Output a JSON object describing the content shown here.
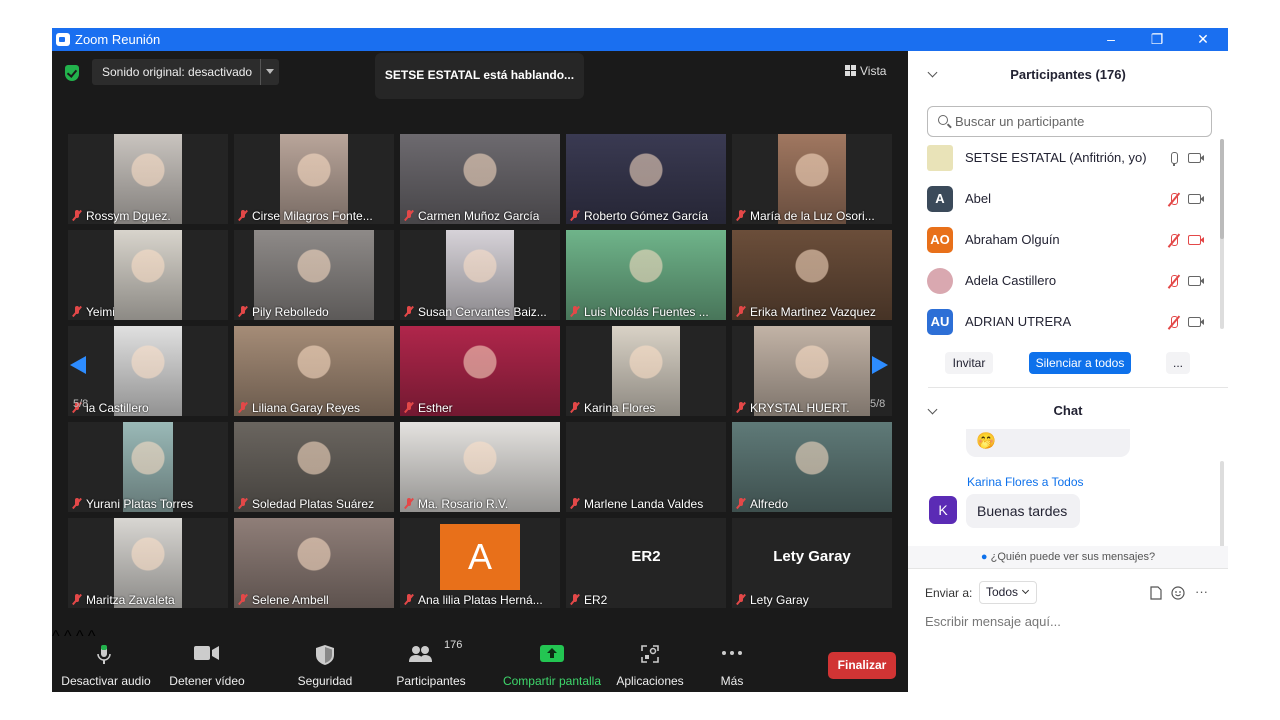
{
  "window": {
    "title": "Zoom Reunión",
    "minimize": "–",
    "restore": "❐",
    "close": "✕"
  },
  "topbar": {
    "audio_label": "Sonido original: desactivado",
    "speaking": "SETSE ESTATAL está hablando...",
    "view_label": "Vista"
  },
  "grid": {
    "page_left": "5/8",
    "page_right": "5/8",
    "tiles": [
      {
        "name": "Rossym Dguez.",
        "bg": "#c9c4bf",
        "kind": "video"
      },
      {
        "name": "Cirse Milagros Fonte...",
        "bg": "#b9a59a",
        "kind": "video"
      },
      {
        "name": "Carmen Muñoz García",
        "bg": "#6d6a6f",
        "kind": "video"
      },
      {
        "name": "Roberto Gómez García",
        "bg": "#3a3a52",
        "kind": "video"
      },
      {
        "name": "María de la Luz Osori...",
        "bg": "#a07760",
        "kind": "video"
      },
      {
        "name": "Yeimi",
        "bg": "#d8d4cc",
        "kind": "video"
      },
      {
        "name": "Pily Rebolledo",
        "bg": "#8e8a88",
        "kind": "video"
      },
      {
        "name": "Susan Cervantes Baiz...",
        "bg": "#d6d2d8",
        "kind": "video"
      },
      {
        "name": "Luis Nicolás Fuentes ...",
        "bg": "#6fb48a",
        "kind": "video"
      },
      {
        "name": "Erika Martinez Vazquez",
        "bg": "#6b4e3a",
        "kind": "video"
      },
      {
        "name": "la Castillero",
        "bg": "#e0e0e0",
        "kind": "video"
      },
      {
        "name": "Liliana Garay Reyes",
        "bg": "#a58c77",
        "kind": "video"
      },
      {
        "name": "Esther",
        "bg": "#b0264b",
        "kind": "video"
      },
      {
        "name": "Karina Flores",
        "bg": "#d9d2c6",
        "kind": "video"
      },
      {
        "name": "KRYSTAL HUERT.",
        "bg": "#c2b3a6",
        "kind": "video"
      },
      {
        "name": "Yurani Platas Torres",
        "bg": "#9ab9b7",
        "kind": "video"
      },
      {
        "name": "Soledad Platas Suárez",
        "bg": "#6a655f",
        "kind": "video"
      },
      {
        "name": "Ma.  Rosario  R.V.",
        "bg": "#e4e2df",
        "kind": "video"
      },
      {
        "name": "Marlene Landa Valdes",
        "bg": "#242424",
        "kind": "empty"
      },
      {
        "name": "Alfredo",
        "bg": "#5f7a78",
        "kind": "video"
      },
      {
        "name": "Maritza Zavaleta",
        "bg": "#d8d6d2",
        "kind": "video"
      },
      {
        "name": "Selene Ambell",
        "bg": "#8f7e78",
        "kind": "video"
      },
      {
        "name": "Ana lilia Platas Herná...",
        "bg": "#242424",
        "kind": "avatar",
        "letter": "A"
      },
      {
        "name": "ER2",
        "bg": "#242424",
        "kind": "text",
        "big": "ER2"
      },
      {
        "name": "Lety Garay",
        "bg": "#242424",
        "kind": "text",
        "big": "Lety Garay"
      }
    ]
  },
  "toolbar": {
    "audio": "Desactivar audio",
    "video": "Detener vídeo",
    "security": "Seguridad",
    "participants": "Participantes",
    "participants_count": "176",
    "share": "Compartir pantalla",
    "apps": "Aplicaciones",
    "more": "Más",
    "end": "Finalizar"
  },
  "participants": {
    "header": "Participantes (176)",
    "search_placeholder": "Buscar un participante",
    "list": [
      {
        "initials": "",
        "name": "SETSE ESTATAL (Anfitrión, yo)",
        "color": "#e9e3b8",
        "mic": "on",
        "cam": "off-plain"
      },
      {
        "initials": "A",
        "name": "Abel",
        "color": "#3b4a5a",
        "mic": "muted",
        "cam": "plain"
      },
      {
        "initials": "AO",
        "name": "Abraham Olguín",
        "color": "#e8701a",
        "mic": "muted",
        "cam": "muted"
      },
      {
        "initials": "",
        "name": "Adela Castillero",
        "color": "#d9a8b0",
        "mic": "muted",
        "cam": "plain"
      },
      {
        "initials": "AU",
        "name": "ADRIAN UTRERA",
        "color": "#2d6fd6",
        "mic": "muted",
        "cam": "plain"
      }
    ],
    "invite": "Invitar",
    "mute_all": "Silenciar a todos",
    "more": "..."
  },
  "chat": {
    "header": "Chat",
    "emoji_bubble": "🤭",
    "sender": "Karina Flores a Todos",
    "sender_initial": "K",
    "message": "Buenas tardes",
    "who_can_see": "¿Quién puede ver sus mensajes?",
    "send_to_label": "Enviar a:",
    "send_to_value": "Todos",
    "compose_placeholder": "Escribir mensaje aquí...",
    "more": "···"
  }
}
